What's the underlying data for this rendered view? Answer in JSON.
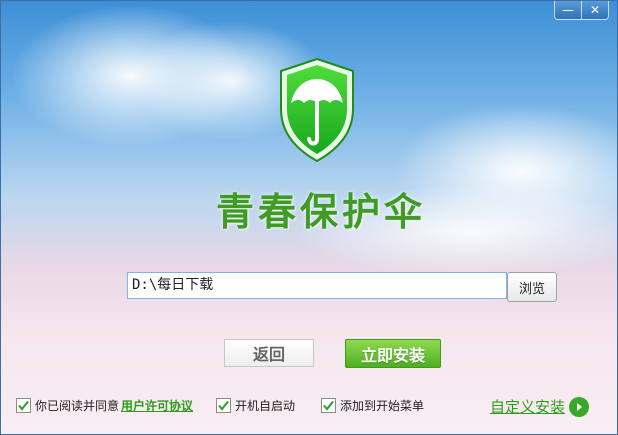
{
  "app": {
    "title": "青春保护伞"
  },
  "window_controls": {
    "minimize": "—",
    "close": "✕"
  },
  "install": {
    "path_value": "D:\\每日下载",
    "browse_label": "浏览",
    "back_label": "返回",
    "install_label": "立即安装"
  },
  "options": {
    "agree_text": "你已阅读并同意",
    "agree_link": "用户许可协议",
    "autostart": "开机自启动",
    "startmenu": "添加到开始菜单"
  },
  "custom_install": {
    "label": "自定义安装"
  },
  "colors": {
    "accent_green": "#3f9a27",
    "install_btn": "#5cb82a",
    "border_blue": "#7fb4e4"
  },
  "icons": {
    "logo": "umbrella-shield-icon",
    "arrow": "arrow-right-icon"
  }
}
